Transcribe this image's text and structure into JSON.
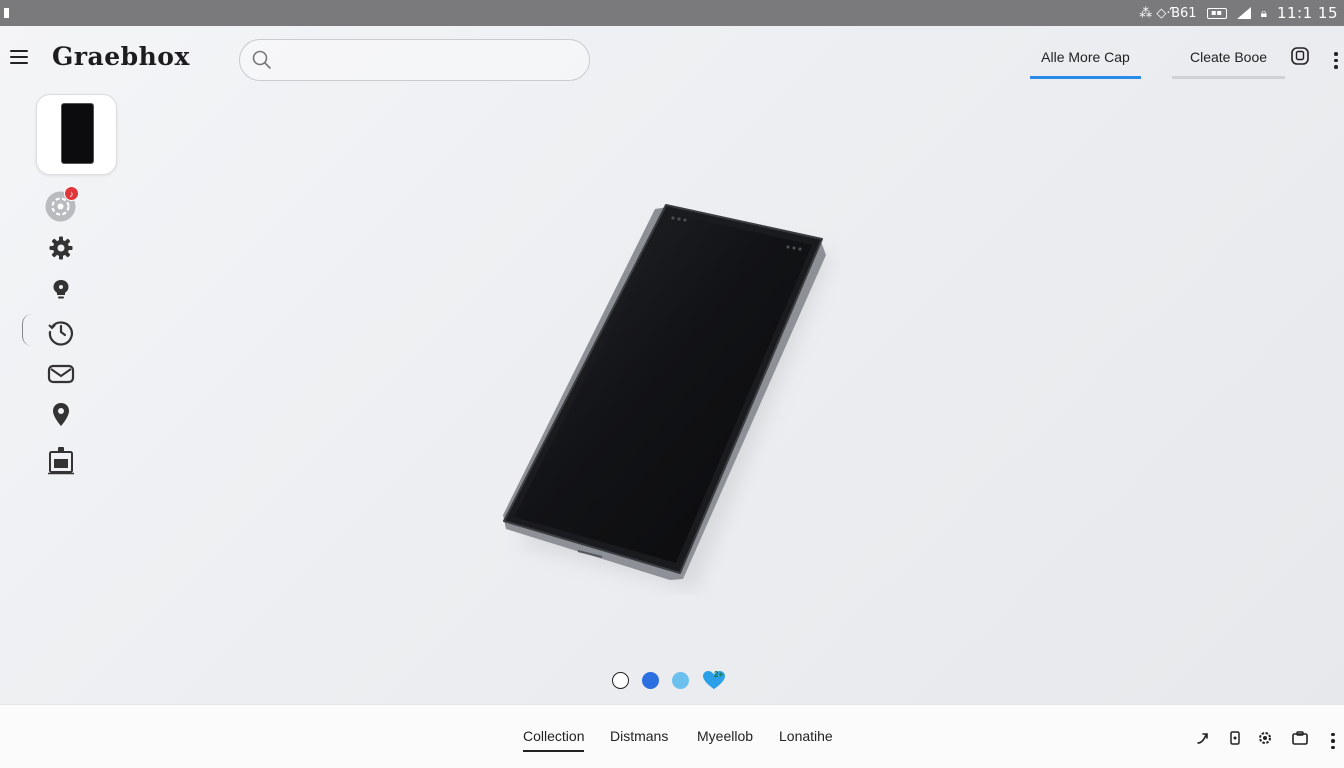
{
  "status_bar": {
    "indicators": "⁂ ◇·Ɓ61",
    "battery": "▪▪",
    "time": "11:1 15"
  },
  "header": {
    "app_title": "Graebhox",
    "search_placeholder": "",
    "tabs": [
      {
        "label": "Alle More Cap",
        "active": true
      },
      {
        "label": "Cleate Booe",
        "active": false
      }
    ]
  },
  "left_rail": {
    "badge_count": "♪",
    "icons": [
      "settings-cycle-icon",
      "gear-icon",
      "lightbulb-icon",
      "history-icon",
      "mail-icon",
      "location-pin-icon",
      "clipboard-icon"
    ]
  },
  "carousel": {
    "dot_colors": [
      "#ffffff",
      "#2c6fe0",
      "#6cc0ee",
      "#2b9fe8"
    ],
    "heart_label": "2+"
  },
  "bottom_nav": {
    "tabs": [
      {
        "label": "Collection",
        "active": true
      },
      {
        "label": "Distmans",
        "active": false
      },
      {
        "label": "Myeellob",
        "active": false
      },
      {
        "label": "Lonatihe",
        "active": false
      }
    ],
    "icons": [
      "share-arrow-icon",
      "bookmark-icon",
      "gear-icon",
      "folder-icon",
      "more-vertical-icon"
    ]
  },
  "colors": {
    "accent": "#2a8ce8",
    "badge": "#e0353b",
    "status_bar": "#7a7a7c"
  }
}
